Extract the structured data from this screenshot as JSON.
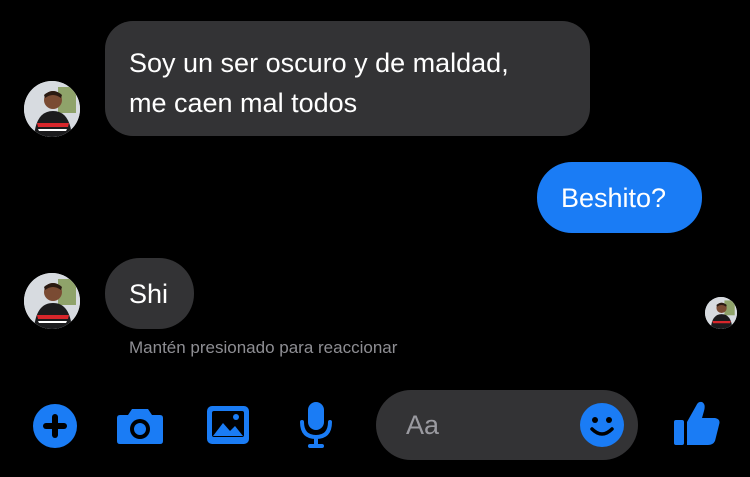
{
  "colors": {
    "background": "#000000",
    "incoming_bubble": "#333335",
    "outgoing_bubble": "#1a7cf5",
    "accent": "#1a7cf5",
    "hint_text": "#8e8e93"
  },
  "conversation": {
    "messages": [
      {
        "direction": "incoming",
        "lines": [
          "Soy un ser oscuro y de maldad,",
          "me caen mal todos"
        ]
      },
      {
        "direction": "outgoing",
        "text": "Beshito?"
      },
      {
        "direction": "incoming",
        "text": "Shi"
      }
    ],
    "reaction_hint": "Mantén presionado para reaccionar"
  },
  "composer": {
    "placeholder": "Aa",
    "icons": [
      "plus-circle-icon",
      "camera-icon",
      "image-icon",
      "microphone-icon",
      "emoji-icon",
      "thumbs-up-icon"
    ]
  }
}
